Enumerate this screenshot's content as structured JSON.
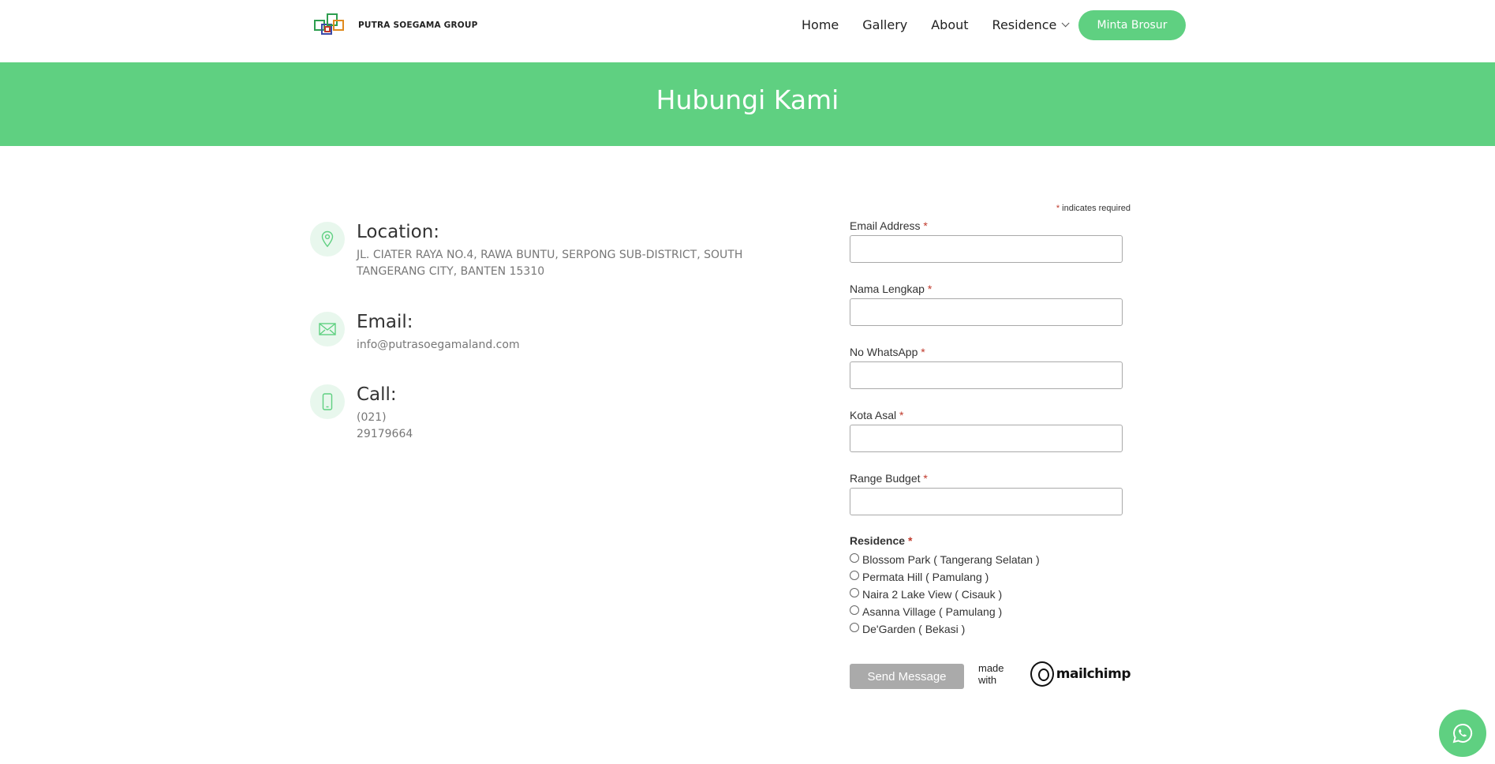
{
  "header": {
    "logo_text": "PUTRA SOEGAMA GROUP",
    "nav": [
      {
        "label": "Home"
      },
      {
        "label": "Gallery"
      },
      {
        "label": "About"
      },
      {
        "label": "Residence"
      }
    ],
    "cta_label": "Minta Brosur"
  },
  "banner": {
    "title": "Hubungi Kami"
  },
  "contact": {
    "location": {
      "title": "Location:",
      "text": "JL. CIATER RAYA NO.4, RAWA BUNTU, SERPONG SUB-DISTRICT, SOUTH TANGERANG CITY, BANTEN 15310",
      "icon": "map-pin-icon"
    },
    "email": {
      "title": "Email:",
      "text": "info@putrasoegamaland.com",
      "icon": "envelope-icon"
    },
    "call": {
      "title": "Call:",
      "text": "(021) 29179664",
      "icon": "phone-icon"
    }
  },
  "form": {
    "required_asterisk": "*",
    "required_note": "indicates required",
    "fields": [
      {
        "label": "Email Address",
        "value": ""
      },
      {
        "label": "Nama Lengkap",
        "value": ""
      },
      {
        "label": "No WhatsApp",
        "value": ""
      },
      {
        "label": "Kota Asal",
        "value": ""
      },
      {
        "label": "Range Budget",
        "value": ""
      }
    ],
    "residence_label": "Residence",
    "residence_options": [
      "Blossom Park ( Tangerang Selatan )",
      "Permata Hill ( Pamulang )",
      "Naira 2 Lake View ( Cisauk )",
      "Asanna Village ( Pamulang )",
      "De'Garden ( Bekasi )"
    ],
    "submit_label": "Send Message",
    "made_with": "made with",
    "mailchimp": "mailchimp"
  },
  "colors": {
    "accent": "#5fd081",
    "required": "#c0392b",
    "button_disabled": "#aaaaaa"
  },
  "floating": {
    "icon": "whatsapp-icon"
  }
}
